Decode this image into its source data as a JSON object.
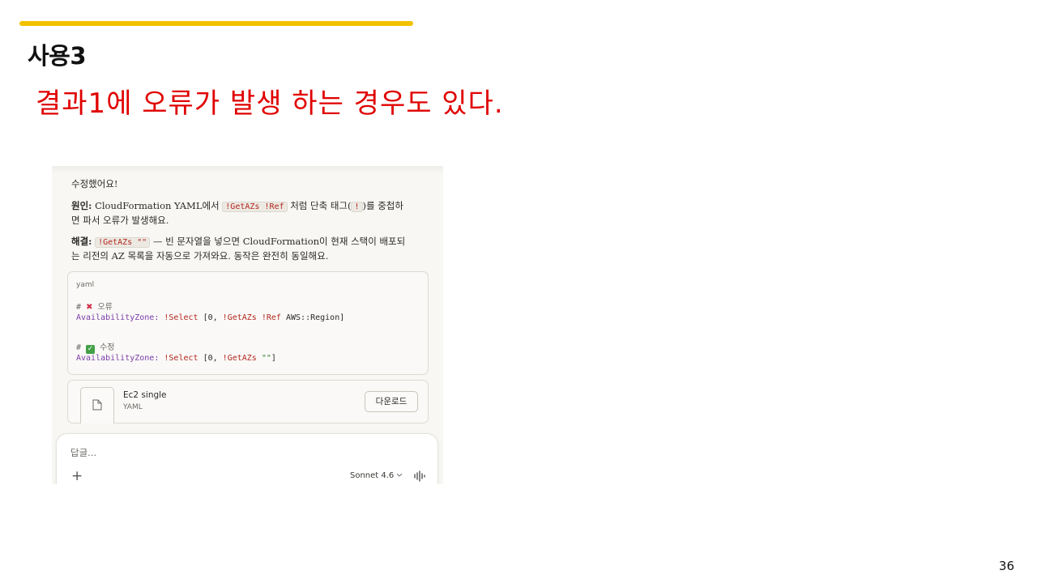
{
  "slide": {
    "title": "사용3",
    "subtitle": "결과1에 오류가 발생 하는 경우도 있다.",
    "page_number": "36"
  },
  "chat": {
    "fixed_text": "수정했어요!",
    "cause_label": "원인:",
    "cause_text_1": "CloudFormation YAML에서",
    "cause_code_1": "!GetAZs !Ref",
    "cause_text_2": "처럼 단축 태그(",
    "cause_code_2": "!",
    "cause_text_3": ")를 중첩하",
    "cause_text_4": "면 파서 오류가 발생해요.",
    "solution_label": "해결:",
    "solution_code": "!GetAZs \"\"",
    "solution_text_1": "— 빈 문자열을 넣으면 CloudFormation이 현재 스택이 배포되",
    "solution_text_2": "는 리전의 AZ 목록을 자동으로 가져와요. 동작은 완전히 동일해요.",
    "code_block": {
      "language": "yaml",
      "error_comment": "오류",
      "error_key": "AvailabilityZone:",
      "error_select": "!Select",
      "error_open": "[0,",
      "error_getazs": "!GetAZs",
      "error_ref": "!Ref",
      "error_rest": "AWS::Region]",
      "fixed_comment": "수정",
      "fixed_key": "AvailabilityZone:",
      "fixed_select": "!Select",
      "fixed_open": "[0,",
      "fixed_getazs": "!GetAZs",
      "fixed_value": "\"\"",
      "fixed_close": "]"
    },
    "file": {
      "name": "Ec2 single",
      "type": "YAML",
      "download_label": "다운로드"
    },
    "reply": {
      "placeholder": "답글...",
      "model": "Sonnet 4.6"
    }
  },
  "icons": {
    "error": "cross-mark-icon",
    "fixed": "check-mark-icon",
    "file": "document-icon",
    "add": "plus-icon",
    "model_dropdown": "chevron-down-icon",
    "voice": "voice-waveform-icon"
  },
  "colors": {
    "accent_bar": "#f2c200",
    "subtitle": "#e00000",
    "code_keyword": "#7a3ca8",
    "code_tag": "#b3261e",
    "code_string": "#2e7d32"
  }
}
